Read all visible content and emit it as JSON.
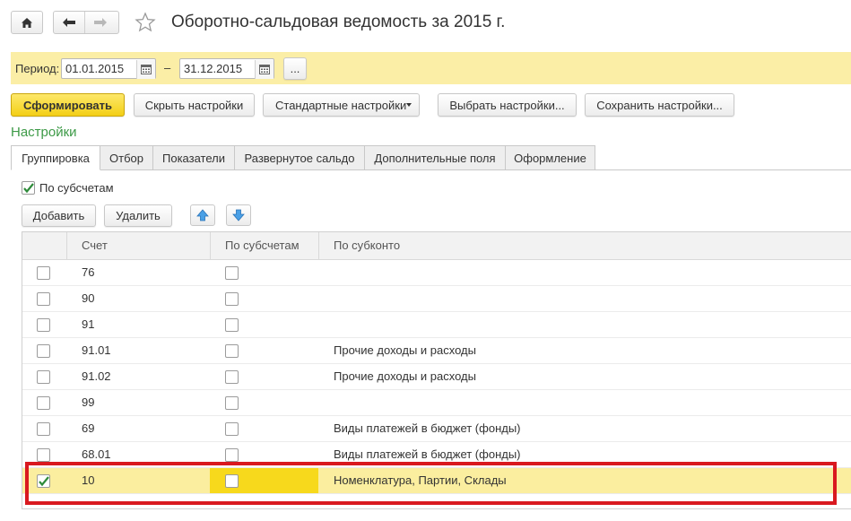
{
  "header": {
    "title": "Оборотно-сальдовая ведомость за 2015 г."
  },
  "period": {
    "label": "Период:",
    "from": "01.01.2015",
    "dash": "–",
    "to": "31.12.2015",
    "more_label": "..."
  },
  "toolbar": {
    "generate_label": "Сформировать",
    "hide_settings_label": "Скрыть настройки",
    "standard_settings_label": "Стандартные настройки",
    "choose_settings_label": "Выбрать настройки...",
    "save_settings_label": "Сохранить настройки..."
  },
  "settings": {
    "title": "Настройки",
    "tabs": [
      {
        "label": "Группировка"
      },
      {
        "label": "Отбор"
      },
      {
        "label": "Показатели"
      },
      {
        "label": "Развернутое сальдо"
      },
      {
        "label": "Дополнительные поля"
      },
      {
        "label": "Оформление"
      }
    ],
    "by_subaccounts": {
      "label": "По субсчетам",
      "checked": true
    },
    "add_label": "Добавить",
    "delete_label": "Удалить"
  },
  "grid": {
    "columns": [
      "Счет",
      "По субсчетам",
      "По субконто"
    ],
    "rows": [
      {
        "checked": false,
        "account": "76",
        "subaccounts": false,
        "subconto": ""
      },
      {
        "checked": false,
        "account": "90",
        "subaccounts": false,
        "subconto": ""
      },
      {
        "checked": false,
        "account": "91",
        "subaccounts": false,
        "subconto": ""
      },
      {
        "checked": false,
        "account": "91.01",
        "subaccounts": false,
        "subconto": "Прочие доходы и расходы"
      },
      {
        "checked": false,
        "account": "91.02",
        "subaccounts": false,
        "subconto": "Прочие доходы и расходы"
      },
      {
        "checked": false,
        "account": "99",
        "subaccounts": false,
        "subconto": ""
      },
      {
        "checked": false,
        "account": "69",
        "subaccounts": false,
        "subconto": "Виды платежей в бюджет (фонды)"
      },
      {
        "checked": false,
        "account": "68.01",
        "subaccounts": false,
        "subconto": "Виды платежей в бюджет (фонды)"
      },
      {
        "checked": true,
        "account": "10",
        "subaccounts": false,
        "subconto": "Номенклатура, Партии, Склады",
        "selected": true
      }
    ]
  },
  "colors": {
    "accent_yellow": "#f3cf16",
    "period_bar": "#fbeea6",
    "section_green": "#3d9a47",
    "highlight_red": "#d9191f",
    "check_green": "#2e8b3a"
  }
}
